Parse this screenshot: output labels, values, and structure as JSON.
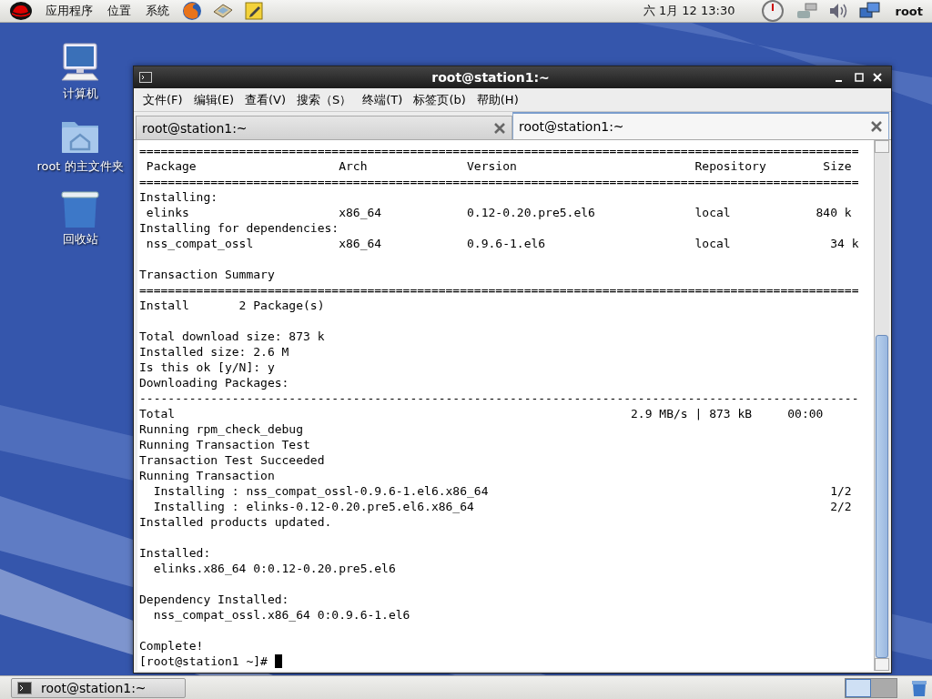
{
  "top_panel": {
    "menus": [
      "应用程序",
      "位置",
      "系统"
    ],
    "clock": "六 1月 12 13:30",
    "user": "root"
  },
  "desktop_icons": [
    {
      "label": "计算机"
    },
    {
      "label": "root 的主文件夹"
    },
    {
      "label": "回收站"
    }
  ],
  "window": {
    "title": "root@station1:~",
    "menu": [
      "文件(F)",
      "编辑(E)",
      "查看(V)",
      "搜索（S）",
      "终端(T)",
      "标签页(b)",
      "帮助(H)"
    ],
    "tabs": [
      {
        "label": "root@station1:~",
        "selected": false
      },
      {
        "label": "root@station1:~",
        "selected": true
      }
    ],
    "terminal": {
      "blocks": [
        [
          "=====================================================================================================",
          " Package                    Arch              Version                         Repository        Size",
          "=====================================================================================================",
          "Installing:",
          " elinks                     x86_64            0.12-0.20.pre5.el6              local            840 k",
          "Installing for dependencies:",
          " nss_compat_ossl            x86_64            0.9.6-1.el6                     local              34 k"
        ],
        [
          "Transaction Summary",
          "=====================================================================================================",
          "Install       2 Package(s)"
        ],
        [
          "Total download size: 873 k",
          "Installed size: 2.6 M",
          "Is this ok [y/N]: y",
          "Downloading Packages:",
          "-----------------------------------------------------------------------------------------------------",
          "Total                                                                2.9 MB/s | 873 kB     00:00",
          "Running rpm_check_debug",
          "Running Transaction Test",
          "Transaction Test Succeeded",
          "Running Transaction",
          "  Installing : nss_compat_ossl-0.9.6-1.el6.x86_64                                                1/2",
          "  Installing : elinks-0.12-0.20.pre5.el6.x86_64                                                  2/2",
          "Installed products updated."
        ],
        [
          "Installed:",
          "  elinks.x86_64 0:0.12-0.20.pre5.el6"
        ],
        [
          "Dependency Installed:",
          "  nss_compat_ossl.x86_64 0:0.9.6-1.el6"
        ],
        [
          "Complete!",
          "[root@station1 ~]# "
        ]
      ]
    }
  },
  "taskbar": {
    "tasks": [
      {
        "label": "root@station1:~"
      }
    ],
    "workspaces": [
      {
        "selected": true
      },
      {
        "selected": false
      }
    ]
  }
}
